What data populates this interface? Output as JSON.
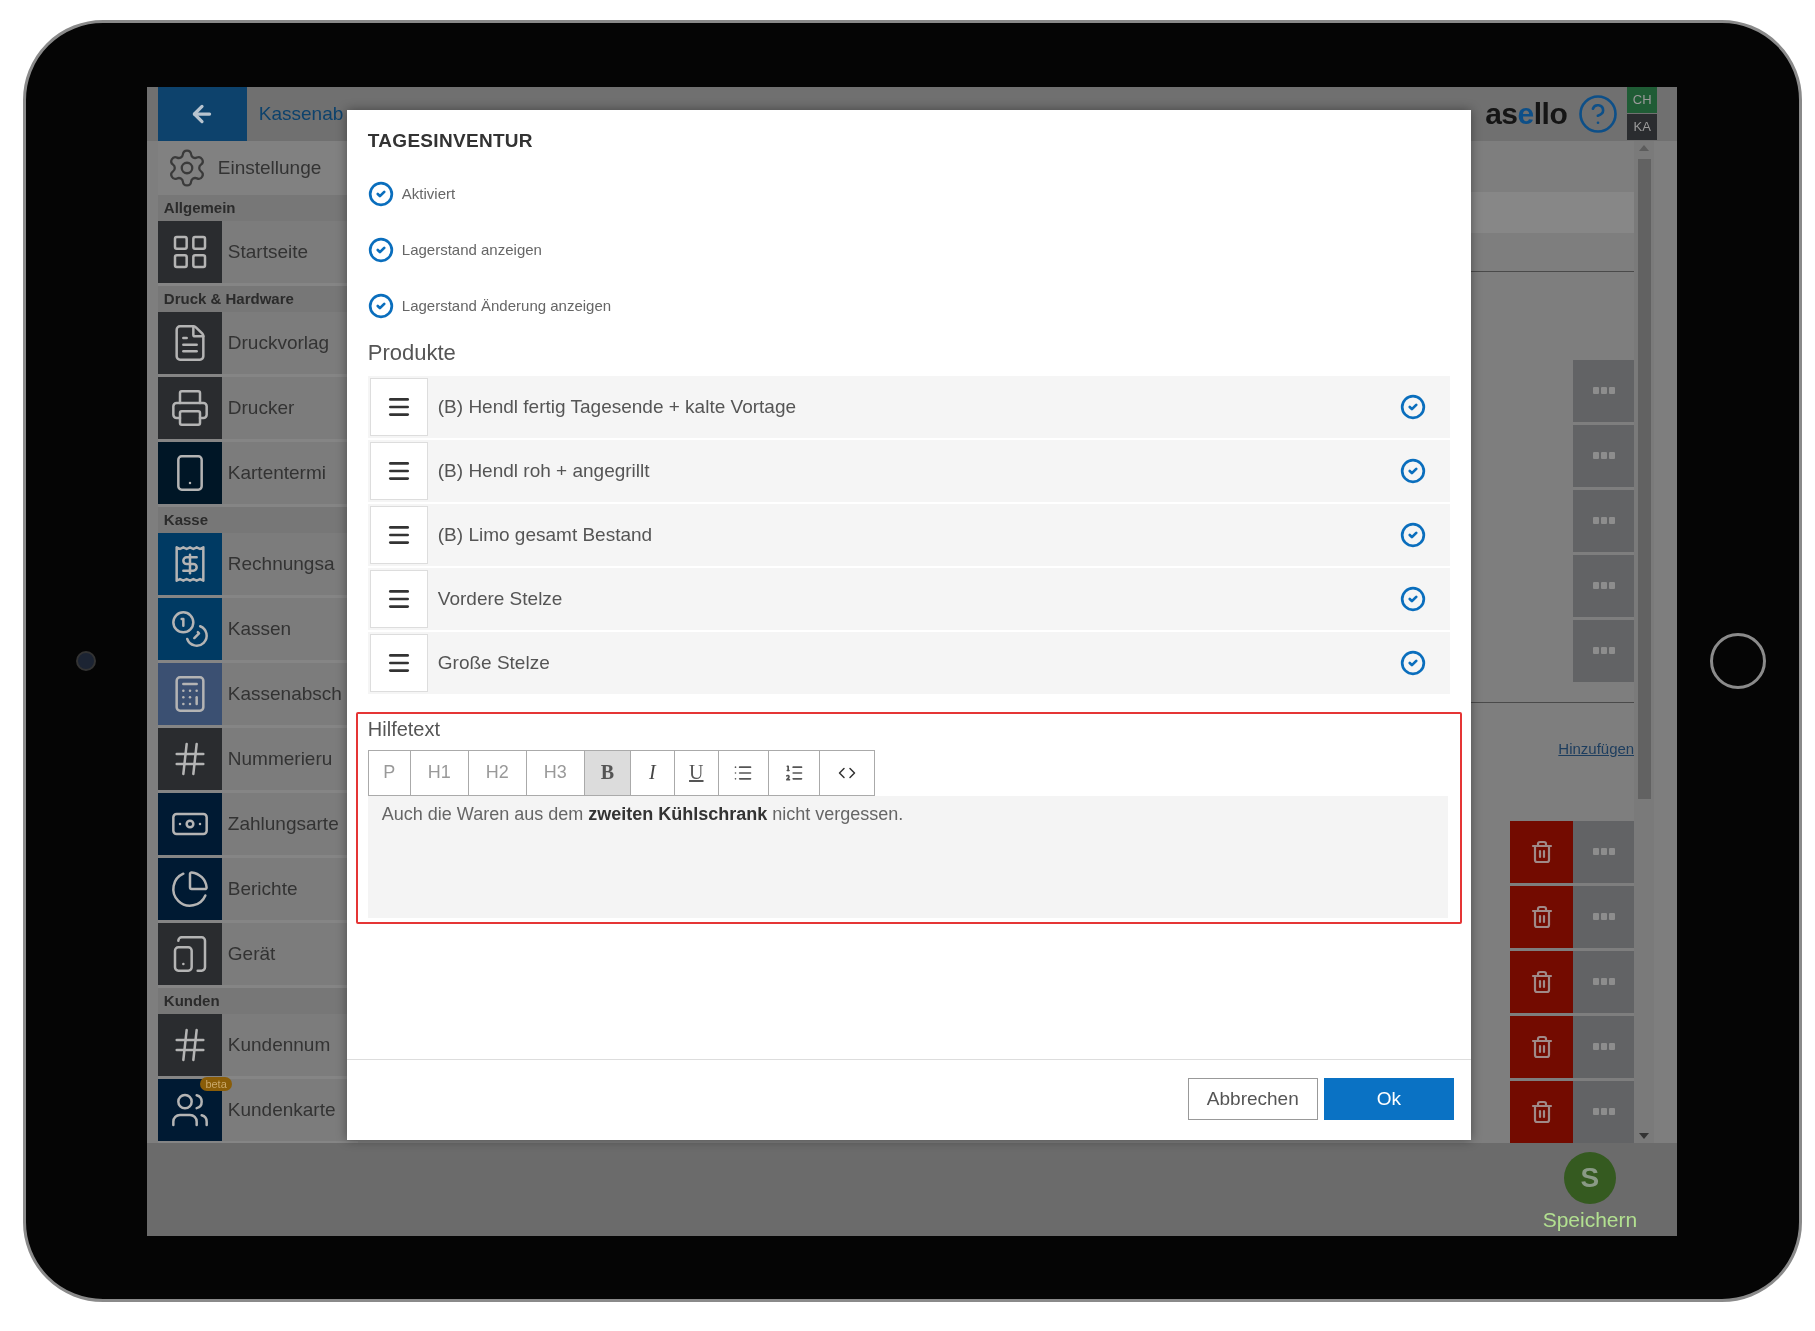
{
  "topbar": {
    "title": "Kassenab",
    "logo": "asello",
    "badges": [
      {
        "label": "CH",
        "color": "#1f5c35"
      },
      {
        "label": "KA",
        "color": "#2a2c2f"
      }
    ]
  },
  "sidebar": {
    "header": "Einstellunge",
    "sections": [
      {
        "title": "Allgemein",
        "items": [
          {
            "label": "Startseite",
            "kind": "grid",
            "color": "#2a2c2f"
          }
        ]
      },
      {
        "title": "Druck & Hardware",
        "items": [
          {
            "label": "Druckvorlag",
            "kind": "document",
            "color": "#2a2c2f"
          },
          {
            "label": "Drucker",
            "kind": "printer",
            "color": "#2a2c2f"
          },
          {
            "label": "Kartentermi",
            "kind": "terminal",
            "color": "#001626"
          }
        ]
      },
      {
        "title": "Kasse",
        "items": [
          {
            "label": "Rechnungsa",
            "kind": "invoice",
            "color": "#003a63"
          },
          {
            "label": "Kassen",
            "kind": "coins",
            "color": "#003a63"
          },
          {
            "label": "Kassenabsch",
            "kind": "register",
            "color": "#3b5072"
          },
          {
            "label": "Nummerieru",
            "kind": "numbering",
            "color": "#2a2c2f"
          },
          {
            "label": "Zahlungsarte",
            "kind": "banknote",
            "color": "#001a33"
          },
          {
            "label": "Berichte",
            "kind": "chart",
            "color": "#001a33"
          },
          {
            "label": "Gerät",
            "kind": "device",
            "color": "#2a2c2f"
          }
        ]
      },
      {
        "title": "Kunden",
        "items": [
          {
            "label": "Kundennum",
            "kind": "numbering",
            "color": "#2a2c2f"
          },
          {
            "label": "Kundenkarte",
            "kind": "people",
            "color": "#001a33",
            "badge": "beta"
          }
        ]
      }
    ]
  },
  "main": {
    "upper_rows": [
      {
        "deletable": false
      },
      {
        "deletable": false
      },
      {
        "deletable": false
      },
      {
        "deletable": false
      },
      {
        "deletable": false
      }
    ],
    "link": "Hinzufügen",
    "lower_rows": [
      {
        "deletable": true
      },
      {
        "deletable": true
      },
      {
        "deletable": true
      },
      {
        "deletable": true
      },
      {
        "deletable": true
      }
    ]
  },
  "dialog": {
    "title": "TAGESINVENTUR",
    "options": [
      {
        "label": "Aktiviert",
        "checked": true
      },
      {
        "label": "Lagerstand anzeigen",
        "checked": true
      },
      {
        "label": "Lagerstand Änderung anzeigen",
        "checked": true
      }
    ],
    "products_heading": "Produkte",
    "products": [
      {
        "name": "(B) Hendl fertig Tagesende + kalte Vortage",
        "checked": true
      },
      {
        "name": "(B) Hendl roh + angegrillt",
        "checked": true
      },
      {
        "name": "(B) Limo gesamt Bestand",
        "checked": true
      },
      {
        "name": "Vordere Stelze",
        "checked": true
      },
      {
        "name": "Große Stelze",
        "checked": true
      }
    ],
    "help": {
      "label": "Hilfetext",
      "toolbar": [
        {
          "kind": "label",
          "label": "P",
          "selected": false
        },
        {
          "kind": "label",
          "label": "H1",
          "selected": false
        },
        {
          "kind": "label",
          "label": "H2",
          "selected": false
        },
        {
          "kind": "label",
          "label": "H3",
          "selected": false
        },
        {
          "kind": "bold",
          "label": "B",
          "selected": true
        },
        {
          "kind": "italic",
          "label": "I",
          "selected": false
        },
        {
          "kind": "underline",
          "label": "U",
          "selected": false
        },
        {
          "kind": "bullets",
          "selected": false
        },
        {
          "kind": "numbered",
          "selected": false
        },
        {
          "kind": "code",
          "selected": false
        }
      ],
      "text": "Auch die Waren aus dem **zweiten Kühlschrank** nicht vergessen."
    },
    "buttons": [
      {
        "label": "Abbrechen",
        "kind": "secondary"
      },
      {
        "label": "Ok",
        "kind": "primary"
      }
    ]
  },
  "bottombar": {
    "save": {
      "letter": "S",
      "label": "Speichern"
    }
  }
}
